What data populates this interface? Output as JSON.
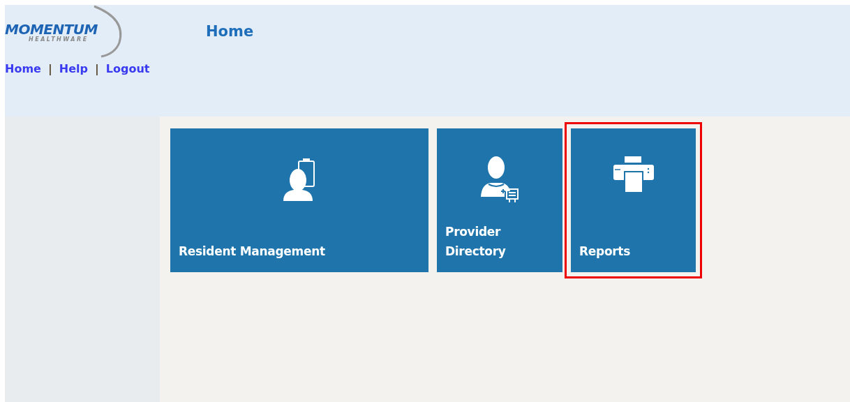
{
  "logo": {
    "name": "MOMENTUM",
    "tagline": "HEALTHWARE"
  },
  "nav_links": [
    {
      "label": "Home"
    },
    {
      "label": "Help"
    },
    {
      "label": "Logout"
    }
  ],
  "nav_separator": "|",
  "page_title": "Home",
  "tiles": [
    {
      "label": "Resident Management",
      "kind": "resident",
      "highlighted": false
    },
    {
      "label": "Provider Directory",
      "kind": "provider",
      "highlighted": false
    },
    {
      "label": "Reports",
      "kind": "printer",
      "highlighted": true
    }
  ]
}
